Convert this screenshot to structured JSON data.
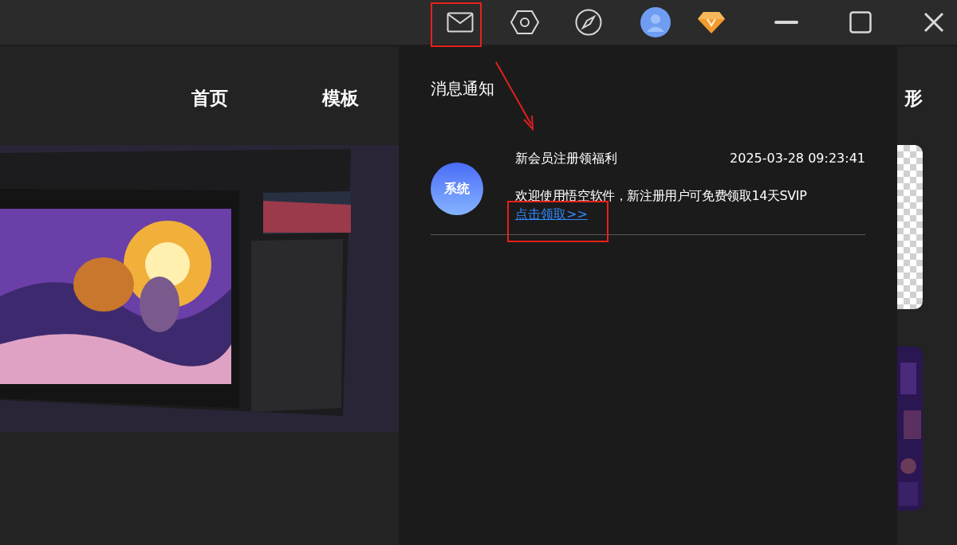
{
  "nav": [
    {
      "label": "首页"
    },
    {
      "label": "模板"
    },
    {
      "label": "形"
    }
  ],
  "notifications": {
    "title": "消息通知",
    "messages": [
      {
        "sender": "系统",
        "title": "新会员注册领福利",
        "time": "2025-03-28 09:23:41",
        "body": "欢迎使用悟空软件，新注册用户可免费领取14天SVIP",
        "link": "点击领取>>"
      }
    ]
  }
}
